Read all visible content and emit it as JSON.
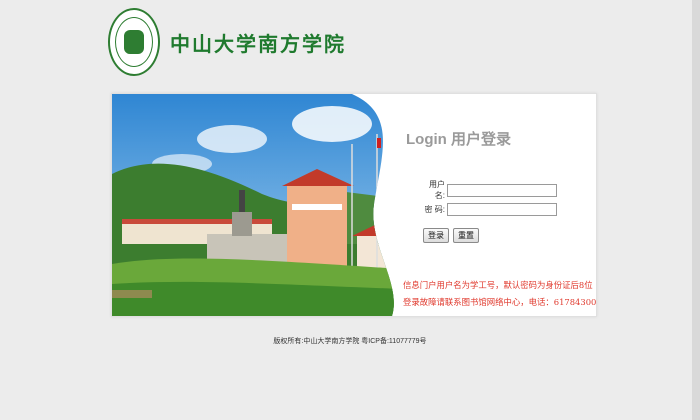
{
  "header": {
    "school_name": "中山大学南方学院"
  },
  "login": {
    "title": "Login 用户登录",
    "username_label": "用户名:",
    "username_value": "",
    "password_label": "密 码:",
    "password_value": "",
    "login_button": "登录",
    "reset_button": "重置"
  },
  "notices": {
    "line1": "信息门户用户名为学工号，默认密码为身份证后8位",
    "line2": "登录故障请联系图书馆网络中心，电话：61784300"
  },
  "footer": {
    "text": "版权所有:中山大学南方学院    粤ICP备:11077779号"
  },
  "colors": {
    "brand_green": "#1f7a2e",
    "notice_red": "#e03a2e"
  }
}
